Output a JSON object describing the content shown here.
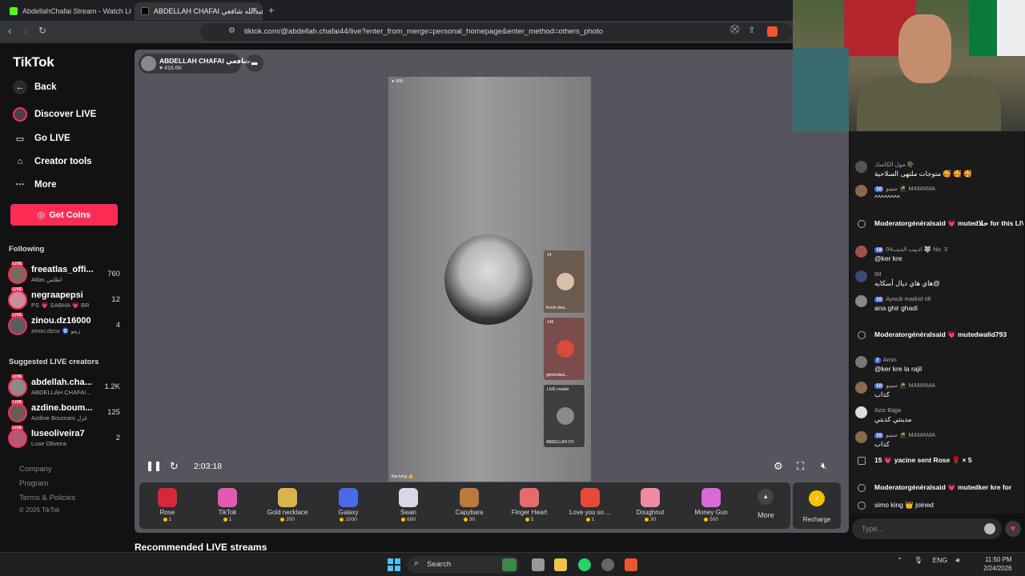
{
  "browser": {
    "tabs": [
      {
        "label": "AbdellahChafai Stream - Watch Live"
      },
      {
        "label": "ABDELLAH CHAFAI عبدالله شافعي"
      }
    ],
    "url": "tiktok.com/@abdellah.chafai44/live?enter_from_merge=personal_homepage&enter_method=others_photo"
  },
  "sidebar": {
    "logo": "TikTok",
    "back": "Back",
    "nav": [
      "Discover LIVE",
      "Go LIVE",
      "Creator tools",
      "More"
    ],
    "get_coins": "Get Coins",
    "following_title": "Following",
    "following": [
      {
        "name": "freeatlas_offi...",
        "sub": "Atlas اطلس",
        "count": "760"
      },
      {
        "name": "negraapepsi",
        "sub": "PS 💗 SABHA 💗 BR",
        "count": "12"
      },
      {
        "name": "zinou.dz16000",
        "sub": "zinou.dzoz 🧿 زينو",
        "count": "4"
      }
    ],
    "suggested_title": "Suggested LIVE creators",
    "suggested": [
      {
        "name": "abdellah.cha...",
        "sub": "ABDELLAH CHAFAI...",
        "count": "1.2K"
      },
      {
        "name": "azdine.boum...",
        "sub": "Azdine Boumani غزل",
        "count": "125"
      },
      {
        "name": "luseoliveira7",
        "sub": "Luse Oliveira",
        "count": "2"
      }
    ],
    "footer": [
      "Company",
      "Program",
      "Terms & Policies",
      "© 2026 TikTok"
    ],
    "live_badge": "LIVE"
  },
  "player": {
    "host_name": "ABDELLAH CHAFAI شافعي...",
    "host_likes": "416.6K",
    "viewers": "309",
    "timer": "2:03:18",
    "bottom_caption": "the king 👍",
    "cohosts": [
      {
        "count": "14",
        "name": "Kevin dow..."
      },
      {
        "count": "145",
        "name": "généralsai..."
      },
      {
        "count": "LIVE creator",
        "name": "ABDELLAH CH"
      }
    ]
  },
  "gifts": [
    {
      "name": "Rose",
      "price": "1",
      "color": "#d8263b"
    },
    {
      "name": "TikTok",
      "price": "1",
      "color": "#e25bb0"
    },
    {
      "name": "Gold necklace",
      "price": "200",
      "color": "#d9b44a"
    },
    {
      "name": "Galaxy",
      "price": "1000",
      "color": "#4a6ae8"
    },
    {
      "name": "Swan",
      "price": "699",
      "color": "#d7d7e8"
    },
    {
      "name": "Capybara",
      "price": "30",
      "color": "#b97a3a"
    },
    {
      "name": "Finger Heart",
      "price": "5",
      "color": "#e86a6a"
    },
    {
      "name": "Love you so ...",
      "price": "1",
      "color": "#e84a3a"
    },
    {
      "name": "Doughnut",
      "price": "30",
      "color": "#f08aa0"
    },
    {
      "name": "Money Gun",
      "price": "500",
      "color": "#d86ad8"
    }
  ],
  "gifts_more": "More",
  "recharge": "Recharge",
  "recommended_title": "Recommended LIVE streams",
  "chat": {
    "messages": [
      {
        "type": "user",
        "user": "مول الكاسك 🪖",
        "level": "",
        "text": "متوجات ملتهى السلاحية 🥰 🥰 🥰"
      },
      {
        "type": "user",
        "user": "سيبو 🥷 MAMAMA",
        "level": "10",
        "text": "^^^^^^^^"
      },
      {
        "type": "sys",
        "text": "Moderatorgénéralsaid 💗 mutedحلا for this LIVE"
      },
      {
        "type": "user",
        "user": "ادبيب الديب04 🐺 No. 3",
        "level": "18",
        "text": "@ker kre"
      },
      {
        "type": "user",
        "user": "IM",
        "level": "",
        "text": "هاي هاي ديال أسكابه@"
      },
      {
        "type": "user",
        "user": "Ayoub madrid rifi",
        "level": "10",
        "text": "ana ghir ghadi"
      },
      {
        "type": "sys",
        "text": "Moderatorgénéralsaid 💗 mutedwalid793"
      },
      {
        "type": "user",
        "user": "Amin",
        "level": "7",
        "text": "@ker kre la rajil"
      },
      {
        "type": "user",
        "user": "سيبو 🥷 MAMAMA",
        "level": "10",
        "text": "كذاب"
      },
      {
        "type": "user",
        "user": "Aziz Bajja",
        "level": "",
        "text": "مدينتي كذبتي"
      },
      {
        "type": "user",
        "user": "سيبو 🥷 MAMAMA",
        "level": "10",
        "text": "كذاب"
      },
      {
        "type": "sys",
        "text": "15 💗 yacine sent Rose 🌹 × 5"
      },
      {
        "type": "sys",
        "text": "Moderatorgénéralsaid 💗 mutedker kre for"
      },
      {
        "type": "sys",
        "text": "simo king 👑 joined"
      }
    ],
    "placeholder": "Type..."
  },
  "taskbar": {
    "search": "Search",
    "lang": "ENG",
    "time": "11:50 PM",
    "date": "2/24/2026"
  }
}
